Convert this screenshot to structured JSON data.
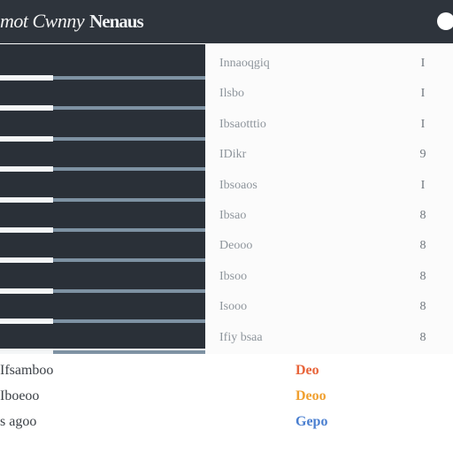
{
  "header": {
    "title_light": "mot Cwnny",
    "title_bold": "Nenaus",
    "dot_color": "#ffffff"
  },
  "left_panel": {
    "bar_rows": 10,
    "colors": {
      "background": "#2a3038",
      "bar_white": "#f4f6f7",
      "bar_blue": "#7e92a3"
    }
  },
  "list": {
    "rows": [
      {
        "label": "Innaoqgiq",
        "value": "I"
      },
      {
        "label": "Ilsbo",
        "value": "I"
      },
      {
        "label": "Ibsaotttio",
        "value": "I"
      },
      {
        "label": "IDikr",
        "value": "9"
      },
      {
        "label": "Ibsoaos",
        "value": "I"
      },
      {
        "label": "Ibsao",
        "value": "8"
      },
      {
        "label": "Deooo",
        "value": "8"
      },
      {
        "label": "Ibsoo",
        "value": "8"
      },
      {
        "label": "Isooo",
        "value": "8"
      },
      {
        "label": "Ifiy bsaa",
        "value": "8"
      }
    ]
  },
  "footer": {
    "rows": [
      {
        "label": "Ifsamboo",
        "tag": "Deo",
        "tag_color": "#e8643a"
      },
      {
        "label": "Iboeoo",
        "tag": "Deoo",
        "tag_color": "#f0a030"
      },
      {
        "label": "s agoo",
        "tag": "Gepo",
        "tag_color": "#4a7fd0"
      }
    ]
  }
}
